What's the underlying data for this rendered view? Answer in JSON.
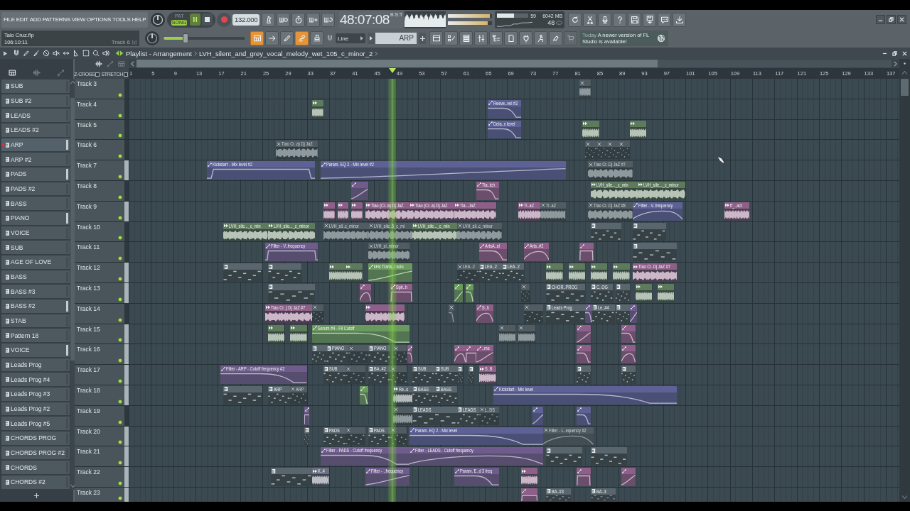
{
  "menu": [
    "FILE",
    "EDIT",
    "ADD",
    "PATTERNS",
    "VIEW",
    "OPTIONS",
    "TOOLS",
    "HELP"
  ],
  "transport": {
    "modes": [
      {
        "label": "PAT",
        "selected": false
      },
      {
        "label": "SONG",
        "selected": true
      }
    ],
    "playing": true,
    "tempo": "132.000"
  },
  "time": {
    "value": "48:07:08",
    "format": "B:S:T"
  },
  "master_sliders": [
    {
      "level": 0.95
    },
    {
      "level": 0.9
    }
  ],
  "cpu": {
    "level": 0.55,
    "reading": "59",
    "memory": "6042 MB",
    "polyphony": "48"
  },
  "hint": {
    "file": "Taio Cruz.flp",
    "position": "106:10:11",
    "target": "Track 6"
  },
  "main_slider": {
    "level": 0.27
  },
  "tool_modes": [
    {
      "selected": true
    },
    {
      "selected": false
    },
    {
      "selected": false
    },
    {
      "selected": true
    },
    {
      "selected": false
    }
  ],
  "snap": {
    "value": "Line"
  },
  "pattern_selector": {
    "value": "ARP"
  },
  "news": {
    "date": "Today",
    "message": "A newer version of FL Studio is available!"
  },
  "playlist": {
    "title": "Playlist - Arrangement",
    "item": "LVH_silent_and_grey_vocal_melody_wet_105_c_minor_2",
    "filters": [
      {
        "selected": true
      },
      {
        "selected": false
      },
      {
        "selected": false
      }
    ],
    "options": [
      {
        "label": "Z-CROSS",
        "checked": false
      },
      {
        "label": "STRETCH",
        "checked": false
      }
    ],
    "ruler": [
      "1",
      "5",
      "9",
      "13",
      "17",
      "21",
      "25",
      "29",
      "33",
      "37",
      "41",
      "45",
      "49",
      "53",
      "57",
      "61",
      "65",
      "69",
      "73",
      "77",
      "81",
      "85",
      "89",
      "93",
      "97",
      "101",
      "105",
      "109",
      "113",
      "117",
      "121",
      "125",
      "129",
      "133",
      "137"
    ]
  },
  "picker": [
    {
      "name": "SUB",
      "selected": false,
      "marked": false
    },
    {
      "name": "SUB #2",
      "selected": false,
      "marked": false
    },
    {
      "name": "LEADS",
      "selected": false,
      "marked": false
    },
    {
      "name": "LEADS #2",
      "selected": false,
      "marked": false
    },
    {
      "name": "ARP",
      "selected": true,
      "marked": true
    },
    {
      "name": "ARP #2",
      "selected": false,
      "marked": false
    },
    {
      "name": "PADS",
      "selected": false,
      "marked": true
    },
    {
      "name": "PADS #2",
      "selected": false,
      "marked": false
    },
    {
      "name": "BASS",
      "selected": false,
      "marked": false
    },
    {
      "name": "PIANO",
      "selected": false,
      "marked": true
    },
    {
      "name": "VOICE",
      "selected": false,
      "marked": false
    },
    {
      "name": "SUB",
      "selected": false,
      "marked": false
    },
    {
      "name": "AGE OF LOVE",
      "selected": false,
      "marked": false
    },
    {
      "name": "BASS",
      "selected": false,
      "marked": false
    },
    {
      "name": "BASS #3",
      "selected": false,
      "marked": false
    },
    {
      "name": "BASS #2",
      "selected": false,
      "marked": true
    },
    {
      "name": "STAB",
      "selected": false,
      "marked": false
    },
    {
      "name": "Pattern 18",
      "selected": false,
      "marked": false
    },
    {
      "name": "VOICE",
      "selected": false,
      "marked": true
    },
    {
      "name": "Leads Prog",
      "selected": false,
      "marked": false
    },
    {
      "name": "Leads Prog #4",
      "selected": false,
      "marked": false
    },
    {
      "name": "Leads Prog #3",
      "selected": false,
      "marked": false
    },
    {
      "name": "Leads Prog #2",
      "selected": false,
      "marked": false
    },
    {
      "name": "Leads Prog #5",
      "selected": false,
      "marked": false
    },
    {
      "name": "CHORDS PROG",
      "selected": false,
      "marked": false
    },
    {
      "name": "CHORDS PROG #2",
      "selected": false,
      "marked": false
    },
    {
      "name": "CHORDS",
      "selected": false,
      "marked": false
    },
    {
      "name": "CHORDS #2",
      "selected": false,
      "marked": false
    }
  ],
  "tracks": [
    {
      "name": "Track 3",
      "active": false,
      "enabled": true,
      "clips": [
        {
          "kind": "audio",
          "muted": true
        }
      ]
    },
    {
      "name": "Track 4",
      "active": false,
      "enabled": true,
      "clips": [
        {
          "kind": "audio",
          "muted": false,
          "color": "#5e7a5c"
        },
        {
          "kind": "automation",
          "name": "Reeve..vel #2",
          "muted": false,
          "color": "#5d6196"
        }
      ]
    },
    {
      "name": "Track 5",
      "active": false,
      "enabled": true,
      "clips": [
        {
          "kind": "automation",
          "name": "Dela..x level",
          "muted": false,
          "color": "#5d6196"
        },
        {
          "kind": "audio",
          "muted": false,
          "color": "#5e7a5c"
        },
        {
          "kind": "audio",
          "muted": false,
          "color": "#5e7a5c"
        }
      ]
    },
    {
      "name": "Track 6",
      "active": false,
      "enabled": true,
      "clips": [
        {
          "kind": "audio",
          "name": "Tiao Cr..a) Dj JaZ",
          "muted": true
        },
        {
          "kind": "pattern",
          "muted": true
        },
        {
          "kind": "pattern",
          "muted": true
        },
        {
          "kind": "pattern",
          "muted": true
        },
        {
          "kind": "pattern",
          "muted": true
        }
      ]
    },
    {
      "name": "Track 7",
      "active": true,
      "enabled": true,
      "clips": [
        {
          "kind": "automation",
          "name": "Kickstart - Mix level #2",
          "muted": false,
          "color": "#5d6196"
        },
        {
          "kind": "automation",
          "name": "Param. EQ 2 - Mix level #2",
          "muted": false,
          "color": "#5d6196"
        },
        {
          "kind": "audio",
          "name": "Tiao Cr..Dj JaZ #7",
          "muted": true
        }
      ]
    },
    {
      "name": "Track 8",
      "active": false,
      "enabled": true,
      "clips": [
        {
          "kind": "automation",
          "muted": false,
          "color": "#6f5c8c"
        },
        {
          "kind": "automation",
          "name": "Tia..tch",
          "muted": false,
          "color": "#8e5f88"
        },
        {
          "kind": "audio",
          "name": "LVH_sile..._c_min",
          "muted": false,
          "color": "#5e7a5c"
        },
        {
          "kind": "audio",
          "name": "LVH_sile..._c_minor",
          "muted": false,
          "color": "#5e7a5c"
        }
      ]
    },
    {
      "name": "Track 9",
      "active": true,
      "enabled": true,
      "clips": [
        {
          "kind": "audio",
          "muted": false,
          "color": "#8e5f88"
        },
        {
          "kind": "audio",
          "muted": false,
          "color": "#8e5f88"
        },
        {
          "kind": "audio",
          "muted": false,
          "color": "#8e5f88"
        },
        {
          "kind": "audio",
          "name": "Tiao (Cr..a) Dj JaZ",
          "muted": false,
          "color": "#8e5f88"
        },
        {
          "kind": "audio",
          "name": "Tiao (Cr..a) Dj JaZ",
          "muted": false,
          "color": "#8e5f88"
        },
        {
          "kind": "audio",
          "name": "Tia...JaZ",
          "muted": false,
          "color": "#8e5f88"
        },
        {
          "kind": "audio",
          "name": "Ti..aZ",
          "muted": false,
          "color": "#8e5f88"
        },
        {
          "kind": "audio",
          "name": "Ti..aZ",
          "muted": true
        },
        {
          "kind": "audio",
          "name": "Tiao Cr..Dj JaZ #8",
          "muted": true
        },
        {
          "kind": "automation",
          "name": "Filter - V..frequency",
          "muted": false,
          "color": "#5d6196"
        },
        {
          "kind": "audio",
          "name": "ff_..act",
          "muted": false,
          "color": "#8e5f88"
        }
      ]
    },
    {
      "name": "Track 10",
      "active": false,
      "enabled": true,
      "clips": [
        {
          "kind": "audio",
          "name": "LVH_sile..._c_min",
          "muted": false,
          "color": "#5e7a5c"
        },
        {
          "kind": "audio",
          "name": "LVH_sile..._c_minor",
          "muted": false,
          "color": "#5e7a5c"
        },
        {
          "kind": "audio",
          "name": "LVH_sil..c_minor",
          "muted": true
        },
        {
          "kind": "audio",
          "name": "LVH_sile..5_c_mi",
          "muted": true
        },
        {
          "kind": "audio",
          "name": "LVH_sile..._c_min",
          "muted": false,
          "color": "#5e7a5c"
        },
        {
          "kind": "audio",
          "name": "LVH_sil..c_minor",
          "muted": true
        },
        {
          "kind": "pattern",
          "muted": false,
          "color": "#5a666d"
        },
        {
          "kind": "pattern",
          "muted": false,
          "color": "#5a666d"
        }
      ]
    },
    {
      "name": "Track 11",
      "active": false,
      "enabled": true,
      "clips": [
        {
          "kind": "automation",
          "name": "Filter - V..frequency",
          "muted": false,
          "color": "#6f5c8c"
        },
        {
          "kind": "audio",
          "name": "LVH_si..minor",
          "muted": true
        },
        {
          "kind": "automation",
          "name": "ArtsA..el",
          "muted": false,
          "color": "#8e5f88"
        },
        {
          "kind": "automation",
          "name": "Arts..#2",
          "muted": false,
          "color": "#8e5f88"
        },
        {
          "kind": "automation",
          "muted": false,
          "color": "#8e5f88"
        },
        {
          "kind": "pattern",
          "muted": false,
          "color": "#5a666d"
        }
      ]
    },
    {
      "name": "Track 12",
      "active": true,
      "enabled": true,
      "clips": [
        {
          "kind": "pattern",
          "muted": false,
          "color": "#5a666d"
        },
        {
          "kind": "pattern",
          "muted": false,
          "color": "#5a666d"
        },
        {
          "kind": "audio",
          "muted": false,
          "color": "#5e7a5c"
        },
        {
          "kind": "audio",
          "muted": false,
          "color": "#5e7a5c"
        },
        {
          "kind": "automation",
          "name": "kHs Trans../ solo",
          "muted": false,
          "color": "#6b9a5e"
        },
        {
          "kind": "pattern",
          "name": "LEA..2",
          "muted": true
        },
        {
          "kind": "pattern",
          "name": "LEA..2",
          "muted": false,
          "color": "#5a666d"
        },
        {
          "kind": "pattern",
          "name": "LEA..2",
          "muted": false,
          "color": "#5a666d"
        },
        {
          "kind": "audio",
          "muted": false,
          "color": "#5e7a5c"
        },
        {
          "kind": "audio",
          "muted": false,
          "color": "#5e7a5c"
        },
        {
          "kind": "audio",
          "muted": false,
          "color": "#5e7a5c"
        },
        {
          "kind": "audio",
          "muted": false,
          "color": "#5e7a5c"
        },
        {
          "kind": "audio",
          "name": "Tiao Cr..Dj JaZ #7",
          "muted": false,
          "color": "#8e5f88"
        }
      ]
    },
    {
      "name": "Track 13",
      "active": true,
      "enabled": true,
      "clips": [
        {
          "kind": "pattern",
          "muted": false,
          "color": "#5a666d"
        },
        {
          "kind": "automation",
          "muted": false,
          "color": "#8e5f88"
        },
        {
          "kind": "automation",
          "name": "Spir..h",
          "muted": false,
          "color": "#8e5f88"
        },
        {
          "kind": "automation",
          "muted": false,
          "color": "#6b9a5e"
        },
        {
          "kind": "automation",
          "muted": false,
          "color": "#6b9a5e"
        },
        {
          "kind": "pattern",
          "muted": true
        },
        {
          "kind": "pattern",
          "name": "CHOR..PROG",
          "muted": false,
          "color": "#5a666d"
        },
        {
          "kind": "pattern",
          "name": "C..OG",
          "muted": false,
          "color": "#5a666d"
        },
        {
          "kind": "pattern",
          "muted": false,
          "color": "#5a666d"
        },
        {
          "kind": "audio",
          "muted": false,
          "color": "#5e7a5c"
        },
        {
          "kind": "audio",
          "muted": false,
          "color": "#5e7a5c"
        }
      ]
    },
    {
      "name": "Track 14",
      "active": false,
      "enabled": true,
      "clips": [
        {
          "kind": "audio",
          "name": "Tiao Cr..) Dj JaZ #7",
          "muted": false,
          "color": "#8e5f88"
        },
        {
          "kind": "pattern",
          "muted": true
        },
        {
          "kind": "audio",
          "muted": false,
          "color": "#8e5f88"
        },
        {
          "kind": "automation",
          "muted": true
        },
        {
          "kind": "automation",
          "name": "S..h",
          "muted": false,
          "color": "#8e5f88"
        },
        {
          "kind": "pattern",
          "muted": true
        },
        {
          "kind": "pattern",
          "name": "Leads Prog",
          "muted": false,
          "color": "#5a666d"
        },
        {
          "kind": "automation",
          "muted": false,
          "color": "#6f5c8c"
        },
        {
          "kind": "pattern",
          "name": "Le..#4",
          "muted": false,
          "color": "#5a666d"
        },
        {
          "kind": "pattern",
          "muted": false,
          "color": "#5a666d"
        },
        {
          "kind": "automation",
          "muted": false,
          "color": "#6f5c8c"
        }
      ]
    },
    {
      "name": "Track 15",
      "active": true,
      "enabled": true,
      "clips": [
        {
          "kind": "audio",
          "muted": false,
          "color": "#5e7a5c"
        },
        {
          "kind": "audio",
          "muted": false,
          "color": "#5e7a5c"
        },
        {
          "kind": "automation",
          "name": "Serum #4 - Fil Cutoff",
          "muted": false,
          "color": "#6b9a5e"
        },
        {
          "kind": "audio",
          "muted": true
        },
        {
          "kind": "audio",
          "muted": true
        },
        {
          "kind": "automation",
          "muted": false,
          "color": "#8e5f88"
        },
        {
          "kind": "automation",
          "muted": false,
          "color": "#8e5f88"
        }
      ]
    },
    {
      "name": "Track 16",
      "active": true,
      "enabled": true,
      "clips": [
        {
          "kind": "pattern",
          "muted": false,
          "color": "#5a666d"
        },
        {
          "kind": "pattern",
          "name": "PIANO",
          "muted": false,
          "color": "#5a666d"
        },
        {
          "kind": "pattern",
          "muted": true
        },
        {
          "kind": "pattern",
          "name": "PIANO",
          "muted": false,
          "color": "#5a666d"
        },
        {
          "kind": "pattern",
          "muted": true
        },
        {
          "kind": "automation",
          "muted": false,
          "color": "#8e5f88"
        },
        {
          "kind": "automation",
          "muted": false,
          "color": "#8e5f88"
        },
        {
          "kind": "automation",
          "muted": false,
          "color": "#8e5f88"
        },
        {
          "kind": "automation",
          "name": "..me",
          "muted": false,
          "color": "#8e5f88"
        },
        {
          "kind": "automation",
          "muted": false,
          "color": "#8e5f88"
        },
        {
          "kind": "automation",
          "muted": false,
          "color": "#8e5f88"
        }
      ]
    },
    {
      "name": "Track 17",
      "active": true,
      "enabled": true,
      "clips": [
        {
          "kind": "automation",
          "name": "Filter - ARP - Cutoff frequency #2",
          "muted": false,
          "color": "#6f5c8c"
        },
        {
          "kind": "pattern",
          "name": "SUB",
          "muted": false,
          "color": "#5a666d"
        },
        {
          "kind": "pattern",
          "muted": true
        },
        {
          "kind": "pattern",
          "name": "BA..#2",
          "muted": false,
          "color": "#5a666d"
        },
        {
          "kind": "pattern",
          "muted": true
        },
        {
          "kind": "pattern",
          "name": "SUB",
          "muted": false,
          "color": "#5a666d"
        },
        {
          "kind": "pattern",
          "name": "SUB",
          "muted": false,
          "color": "#5a666d"
        },
        {
          "kind": "pattern",
          "muted": false,
          "color": "#5a666d"
        },
        {
          "kind": "pattern",
          "muted": false,
          "color": "#5a666d"
        },
        {
          "kind": "audio",
          "name": "S..B",
          "muted": false,
          "color": "#8e5f88"
        },
        {
          "kind": "pattern",
          "muted": false,
          "color": "#5a666d"
        },
        {
          "kind": "pattern",
          "muted": false,
          "color": "#5a666d"
        }
      ]
    },
    {
      "name": "Track 18",
      "active": true,
      "enabled": true,
      "clips": [
        {
          "kind": "pattern",
          "muted": false,
          "color": "#5a666d"
        },
        {
          "kind": "pattern",
          "name": "ARP",
          "muted": false,
          "color": "#5a666d"
        },
        {
          "kind": "pattern",
          "name": "ARP",
          "muted": true
        },
        {
          "kind": "automation",
          "muted": false,
          "color": "#6b9a5e"
        },
        {
          "kind": "audio",
          "name": "Re..s",
          "muted": false,
          "color": "#5a666d"
        },
        {
          "kind": "pattern",
          "name": "BASS",
          "muted": false,
          "color": "#5a666d"
        },
        {
          "kind": "pattern",
          "name": "BASS",
          "muted": false,
          "color": "#5a666d"
        },
        {
          "kind": "automation",
          "name": "Kickstart - Mix level",
          "muted": false,
          "color": "#5d6196"
        }
      ]
    },
    {
      "name": "Track 19",
      "active": false,
      "enabled": true,
      "clips": [
        {
          "kind": "automation",
          "muted": false,
          "color": "#6f5c8c"
        },
        {
          "kind": "audio",
          "muted": true
        },
        {
          "kind": "pattern",
          "name": "LEADS",
          "muted": false,
          "color": "#5a666d"
        },
        {
          "kind": "pattern",
          "name": "LEADS",
          "muted": false,
          "color": "#5a666d"
        },
        {
          "kind": "pattern",
          "name": "L..DS",
          "muted": true
        },
        {
          "kind": "automation",
          "muted": false,
          "color": "#5d6196"
        },
        {
          "kind": "automation",
          "muted": false,
          "color": "#5d6196"
        }
      ]
    },
    {
      "name": "Track 20",
      "active": true,
      "enabled": true,
      "clips": [
        {
          "kind": "pattern",
          "muted": false,
          "color": "#5a666d"
        },
        {
          "kind": "pattern",
          "name": "PADS",
          "muted": false,
          "color": "#5a666d"
        },
        {
          "kind": "pattern",
          "muted": true
        },
        {
          "kind": "pattern",
          "name": "PADS",
          "muted": false,
          "color": "#5a666d"
        },
        {
          "kind": "pattern",
          "muted": true
        },
        {
          "kind": "automation",
          "name": "Param. EQ 2 - Mix level",
          "muted": false,
          "color": "#5d6196"
        },
        {
          "kind": "automation",
          "name": "Filter - L..equency #2",
          "muted": true
        }
      ]
    },
    {
      "name": "Track 21",
      "active": true,
      "enabled": true,
      "clips": [
        {
          "kind": "automation",
          "name": "Filter - PADS - Cutoff frequency",
          "muted": false,
          "color": "#6f5c8c"
        },
        {
          "kind": "automation",
          "name": "Filter - LEADS - Cutoff frequency",
          "muted": false,
          "color": "#6f5c8c"
        },
        {
          "kind": "pattern",
          "muted": false,
          "color": "#5a666d"
        },
        {
          "kind": "pattern",
          "muted": false,
          "color": "#5a666d"
        }
      ]
    },
    {
      "name": "Track 22",
      "active": true,
      "enabled": true,
      "clips": [
        {
          "kind": "pattern",
          "muted": false,
          "color": "#5a666d"
        },
        {
          "kind": "audio",
          "name": "K..4",
          "muted": false,
          "color": "#6a6f80"
        },
        {
          "kind": "automation",
          "name": "Filter - ..frequency",
          "muted": false,
          "color": "#6f5c8c"
        },
        {
          "kind": "automation",
          "name": "Param. E..d 3 freq",
          "muted": false,
          "color": "#6f5c8c"
        },
        {
          "kind": "audio",
          "muted": false,
          "color": "#8e5f88"
        },
        {
          "kind": "automation",
          "muted": false,
          "color": "#8e5f88"
        },
        {
          "kind": "automation",
          "muted": false,
          "color": "#8e5f88"
        }
      ]
    },
    {
      "name": "Track 23",
      "active": true,
      "enabled": true,
      "clips": [
        {
          "kind": "automation",
          "muted": false,
          "color": "#8e5f88"
        },
        {
          "kind": "pattern",
          "name": "BA..#3",
          "muted": false,
          "color": "#5a666d"
        },
        {
          "kind": "pattern",
          "name": "BA..3",
          "muted": false,
          "color": "#5a666d"
        }
      ]
    }
  ]
}
